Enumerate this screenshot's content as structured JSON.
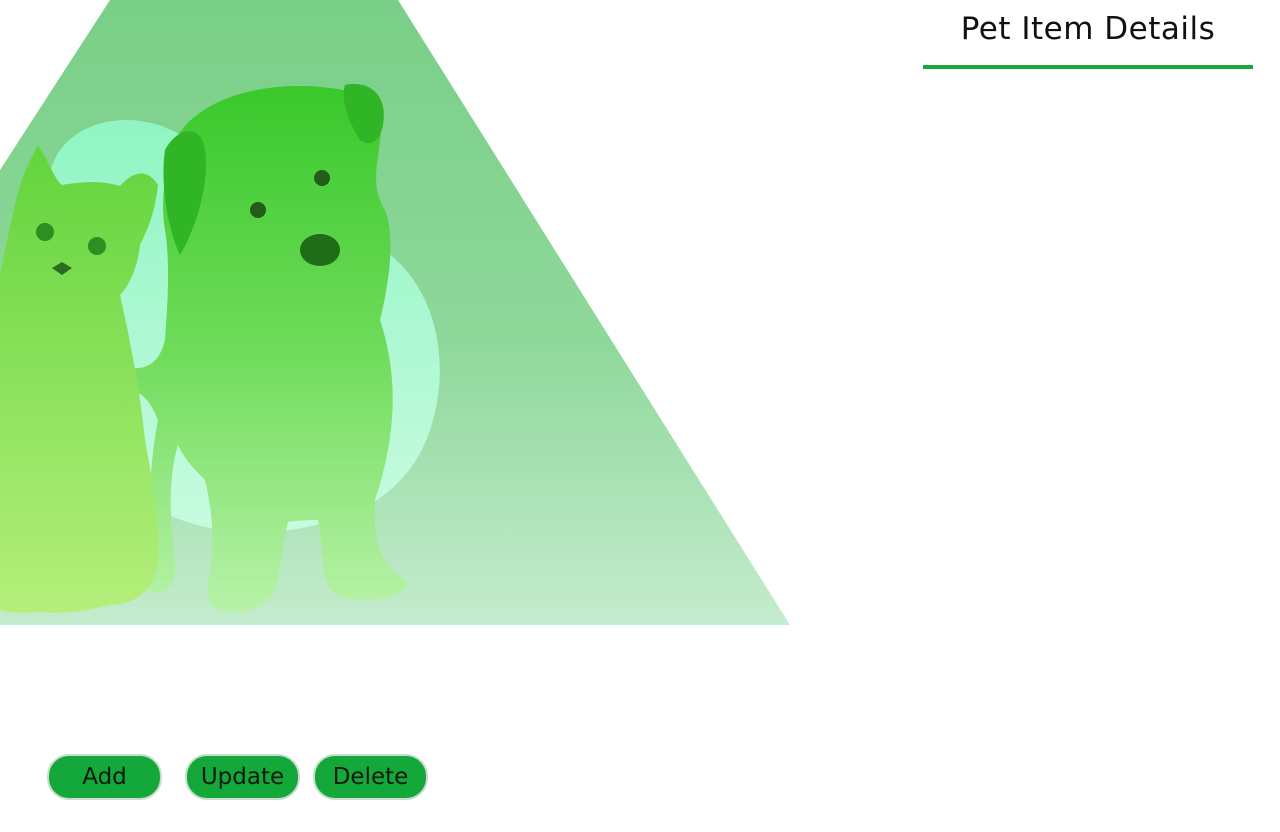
{
  "header": {
    "title": "Pet Item Details"
  },
  "actions": {
    "add_label": "Add",
    "update_label": "Update",
    "delete_label": "Delete"
  },
  "colors": {
    "accent": "#1aa83c",
    "button_bg": "#14a83a",
    "hero_green": "#7dd18a"
  }
}
